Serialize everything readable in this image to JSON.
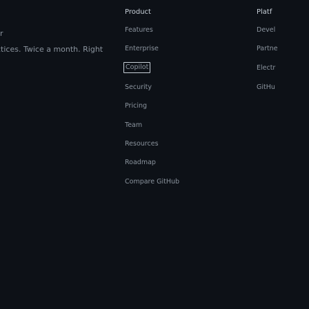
{
  "left": {
    "line1": "r",
    "line2": "ctices. Twice a month. Right"
  },
  "product": {
    "heading": "Product",
    "items": [
      "Features",
      "Enterprise",
      "Copilot",
      "Security",
      "Pricing",
      "Team",
      "Resources",
      "Roadmap",
      "Compare GitHub"
    ]
  },
  "platform": {
    "heading": "Platf",
    "items": [
      "Devel",
      "Partne",
      "Electr",
      "GitHu"
    ]
  }
}
